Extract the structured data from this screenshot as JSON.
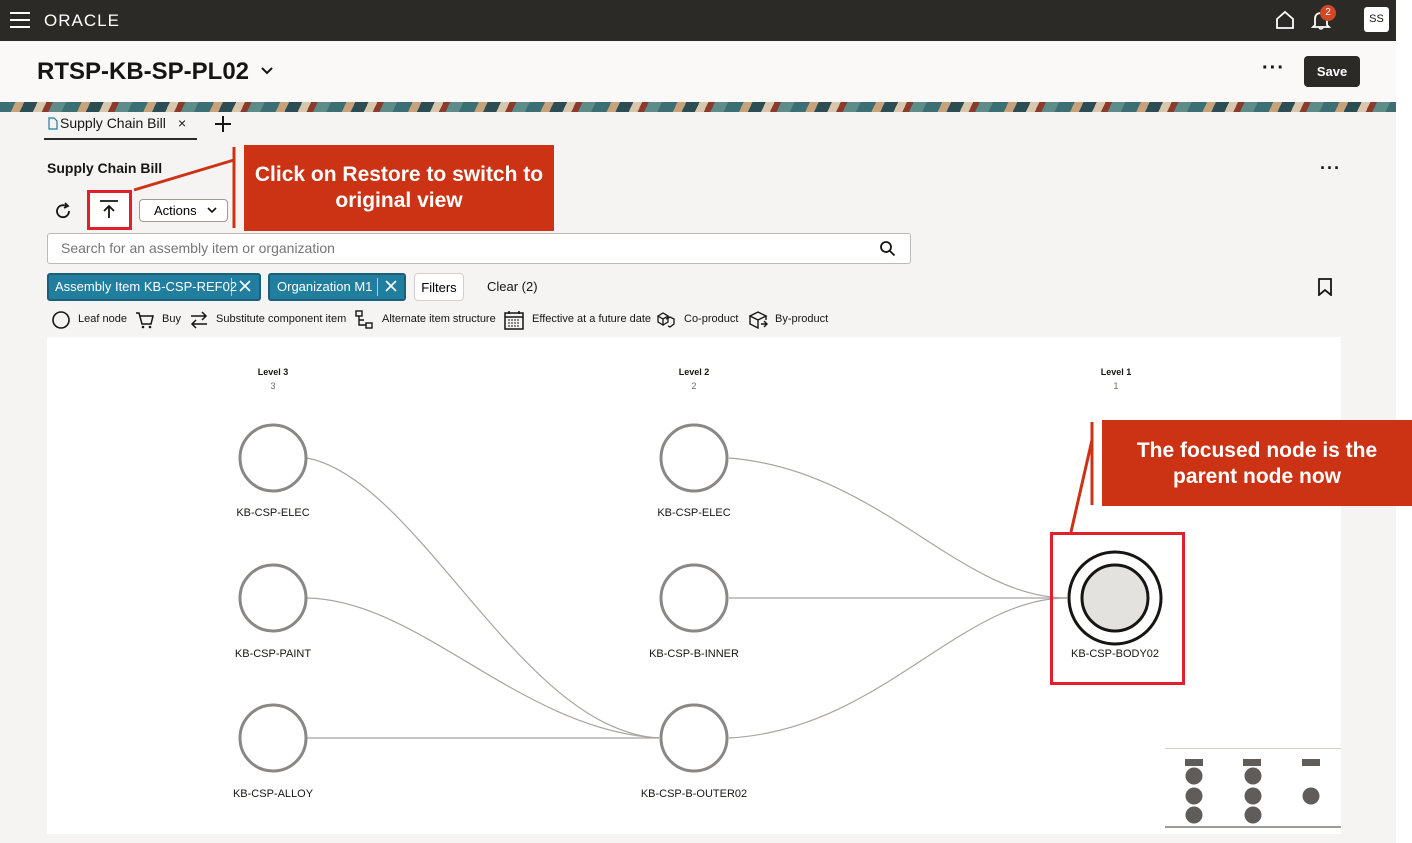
{
  "app": {
    "logo": "ORACLE",
    "notification_count": "2",
    "user_initials": "SS",
    "page_title": "RTSP-KB-SP-PL02",
    "more_label": "···",
    "save_label": "Save"
  },
  "tabs": [
    {
      "label": "Supply Chain Bill",
      "close": "×"
    }
  ],
  "section": {
    "title": "Supply Chain Bill",
    "more_label": "···",
    "actions_label": "Actions"
  },
  "search": {
    "placeholder": "Search for an assembly item or organization"
  },
  "filters": {
    "chips": [
      {
        "label": "Assembly Item KB-CSP-REF02"
      },
      {
        "label": "Organization M1"
      }
    ],
    "filters_label": "Filters",
    "clear_label": "Clear (2)"
  },
  "legend": [
    {
      "label": "Leaf node",
      "icon": "circle-icon"
    },
    {
      "label": "Buy",
      "icon": "cart-icon"
    },
    {
      "label": "Substitute component item",
      "icon": "swap-icon"
    },
    {
      "label": "Alternate item structure",
      "icon": "hierarchy-icon"
    },
    {
      "label": "Effective at a future date",
      "icon": "calendar-icon"
    },
    {
      "label": "Co-product",
      "icon": "co-product-icon"
    },
    {
      "label": "By-product",
      "icon": "by-product-icon"
    }
  ],
  "graph": {
    "levels": [
      {
        "label": "Level 3",
        "count": "3"
      },
      {
        "label": "Level 2",
        "count": "2"
      },
      {
        "label": "Level 1",
        "count": "1"
      }
    ],
    "nodes": {
      "l3_elec": "KB-CSP-ELEC",
      "l3_paint": "KB-CSP-PAINT",
      "l3_alloy": "KB-CSP-ALLOY",
      "l2_elec": "KB-CSP-ELEC",
      "l2_inner": "KB-CSP-B-INNER",
      "l2_outer": "KB-CSP-B-OUTER02",
      "l1_body": "KB-CSP-BODY02"
    }
  },
  "callouts": {
    "restore": "Click on Restore to switch to original view",
    "focused": "The focused node is the parent node now"
  },
  "colors": {
    "topbar": "#2c2a27",
    "chip": "#227e9e",
    "callout": "#cc3314",
    "highlight": "#e0202c"
  }
}
